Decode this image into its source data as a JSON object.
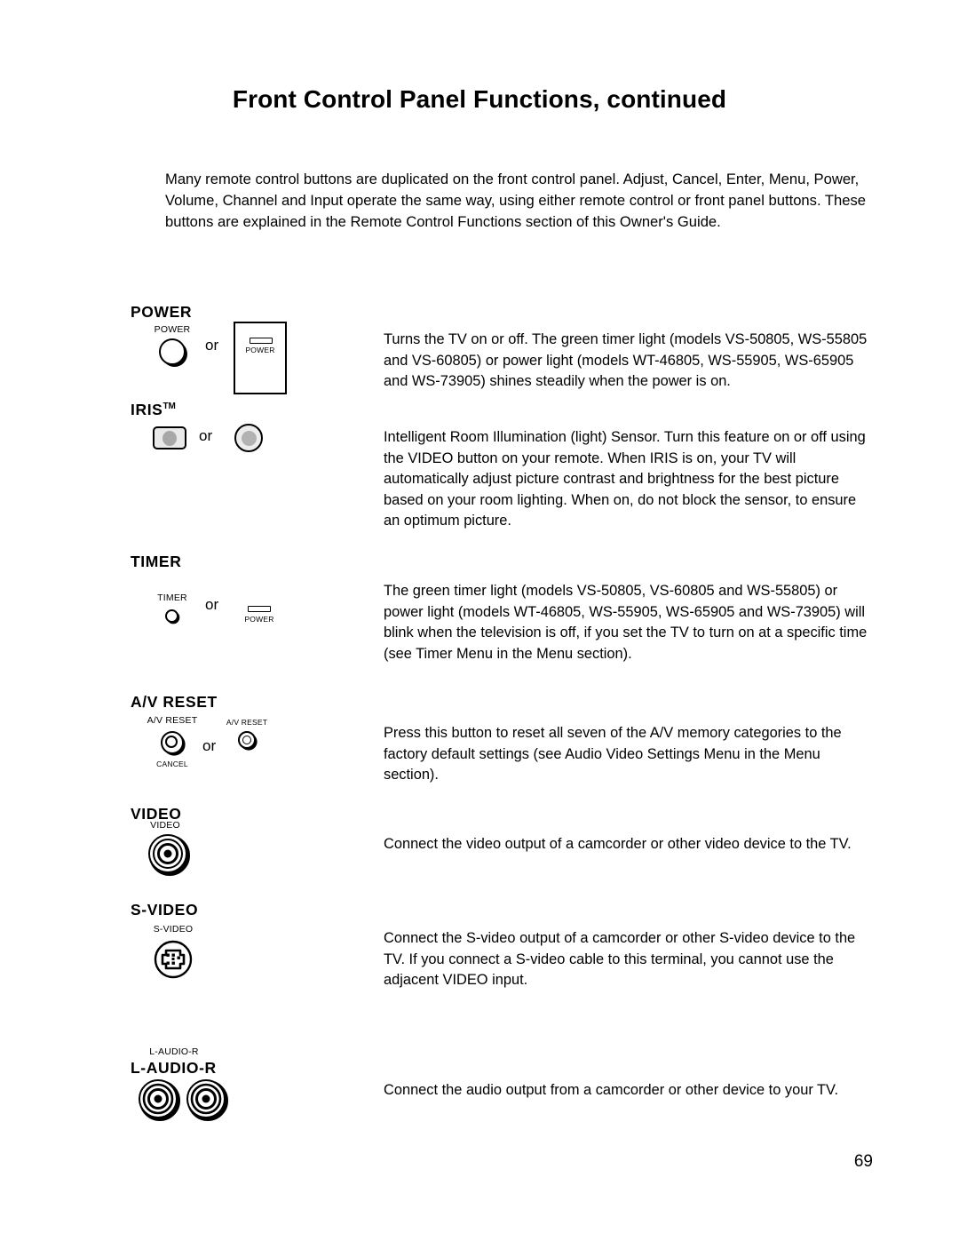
{
  "document": {
    "title": "Front Control Panel Functions, continued",
    "page_number": "69",
    "intro": "Many remote control buttons are duplicated on the front control panel.  Adjust, Cancel, Enter, Menu, Power, Volume, Channel and Input operate the same way, using either remote control or front panel buttons.  These buttons are explained in the Remote Control Functions section of this Owner's Guide."
  },
  "or_label": "or",
  "sections": [
    {
      "heading": "POWER",
      "heading_sup": "",
      "icon_captions": {
        "left_top": "POWER",
        "box_label": "POWER"
      },
      "description": "Turns the TV on or off.  The green timer light (models VS-50805, WS-55805 and VS-60805) or power light (models WT-46805, WS-55905, WS-65905 and WS-73905) shines steadily when the power is on."
    },
    {
      "heading": "IRIS",
      "heading_sup": "TM",
      "icon_captions": {},
      "description": "Intelligent Room Illumination (light) Sensor. Turn this feature on or off using the VIDEO button on your remote. When IRIS is on, your TV will automatically adjust picture contrast and brightness for the best picture based on your room lighting. When on, do not block the sensor, to ensure an optimum picture."
    },
    {
      "heading": "TIMER",
      "heading_sup": "",
      "icon_captions": {
        "left_top": "TIMER",
        "right_bottom": "POWER"
      },
      "description": "The green timer light (models VS-50805, VS-60805 and WS-55805) or power light (models WT-46805, WS-55905, WS-65905 and WS-73905) will blink when the television is off,  if you set the TV to turn on at a specific time (see Timer Menu in the Menu section)."
    },
    {
      "heading": "A/V RESET",
      "heading_sup": "",
      "icon_captions": {
        "left_top": "A/V RESET",
        "left_bottom": "CANCEL",
        "right_top": "A/V RESET"
      },
      "description": "Press this button to reset all seven of the A/V memory categories to the factory default settings (see Audio Video Settings Menu in the Menu section)."
    },
    {
      "heading": "VIDEO",
      "heading_sup": "",
      "icon_captions": {
        "left_top": "VIDEO"
      },
      "description": "Connect the video output of a camcorder or other video device to the TV."
    },
    {
      "heading": "S-VIDEO",
      "heading_sup": "",
      "icon_captions": {
        "left_top": "S-VIDEO"
      },
      "description": "Connect the S-video output of a camcorder or other S-video device to the TV.  If you connect a S-video cable to this terminal,  you cannot use the adjacent VIDEO input."
    },
    {
      "heading": "L-AUDIO-R",
      "heading_sup": "",
      "icon_captions": {
        "left_top": "L-AUDIO-R"
      },
      "description": "Connect the audio output from a camcorder or other device to your TV."
    }
  ]
}
